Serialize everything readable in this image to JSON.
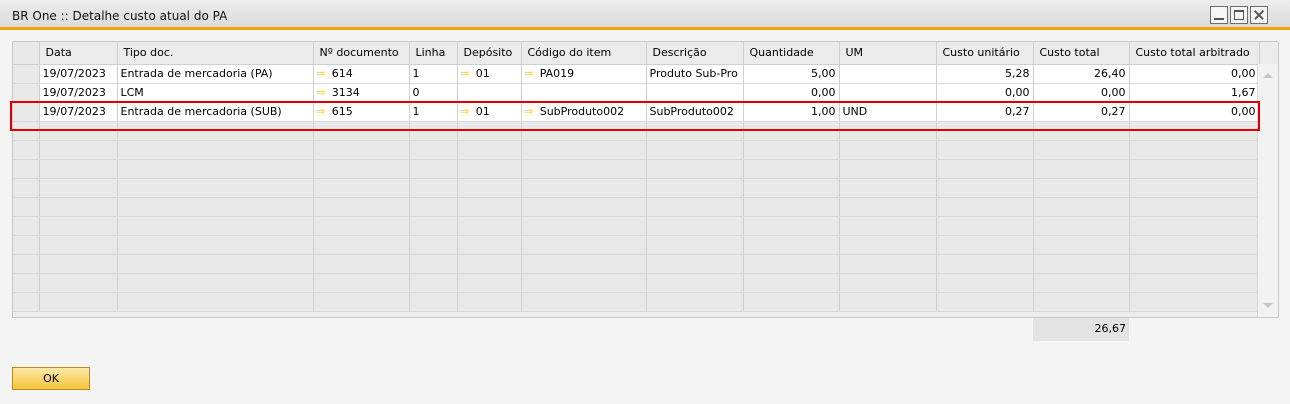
{
  "window": {
    "title": "BR One :: Detalhe custo atual do PA"
  },
  "grid": {
    "columns": [
      "Data",
      "Tipo doc.",
      "Nº documento",
      "Linha",
      "Depósito",
      "Código do item",
      "Descrição",
      "Quantidade",
      "UM",
      "Custo unitário",
      "Custo total",
      "Custo total arbitrado"
    ],
    "rows": [
      {
        "data": "19/07/2023",
        "tipo": "Entrada de mercadoria (PA)",
        "documento": "614",
        "linha": "1",
        "deposito": "01",
        "codigo": "PA019",
        "descricao": "Produto Sub-Pro",
        "quantidade": "5,00",
        "um": "",
        "custo_unitario": "5,28",
        "custo_total": "26,40",
        "custo_arbitrado": "0,00"
      },
      {
        "data": "19/07/2023",
        "tipo": "LCM",
        "documento": "3134",
        "linha": "0",
        "deposito": "",
        "codigo": "",
        "descricao": "",
        "quantidade": "0,00",
        "um": "",
        "custo_unitario": "0,00",
        "custo_total": "0,00",
        "custo_arbitrado": "1,67"
      },
      {
        "data": "19/07/2023",
        "tipo": "Entrada de mercadoria (SUB)",
        "documento": "615",
        "linha": "1",
        "deposito": "01",
        "codigo": "SubProduto002",
        "descricao": "SubProduto002",
        "quantidade": "1,00",
        "um": "UND",
        "custo_unitario": "0,27",
        "custo_total": "0,27",
        "custo_arbitrado": "0,00"
      }
    ],
    "total": "26,67"
  },
  "buttons": {
    "ok": "OK"
  },
  "colors": {
    "accent": "#f0a800",
    "highlight": "#e00000",
    "link_arrow": "#f0c200"
  }
}
